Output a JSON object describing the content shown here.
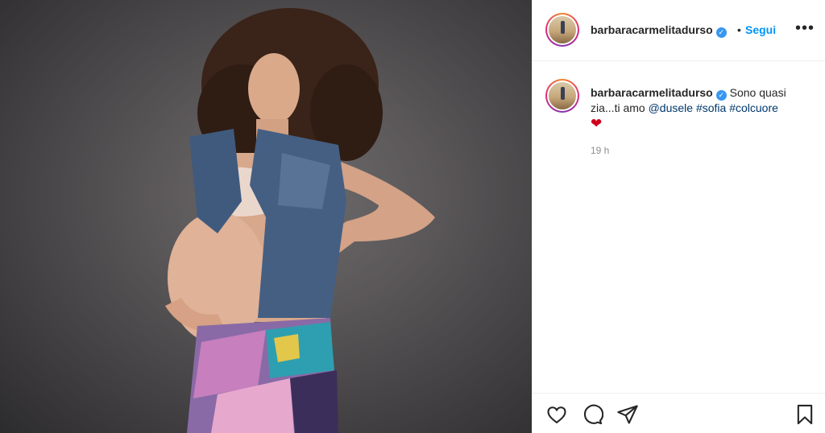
{
  "post": {
    "username": "barbaracarmelitadurso",
    "verified_icon": "verified-badge-icon",
    "separator": "•",
    "follow_label": "Segui",
    "more_label": "•••"
  },
  "caption": {
    "username": "barbaracarmelitadurso",
    "text_before": "Sono quasi zia...ti amo",
    "mention": "@dusele",
    "hashtags": [
      "#sofia",
      "#colcuore"
    ],
    "emoji": "heart-emoji",
    "time": "19 h"
  },
  "actions": [
    "heart-icon",
    "comment-icon",
    "share-icon",
    "bookmark-icon"
  ],
  "colors": {
    "accent": "#0095f6",
    "link": "#00376b",
    "verified": "#3897f0",
    "heart": "#d0021b"
  }
}
